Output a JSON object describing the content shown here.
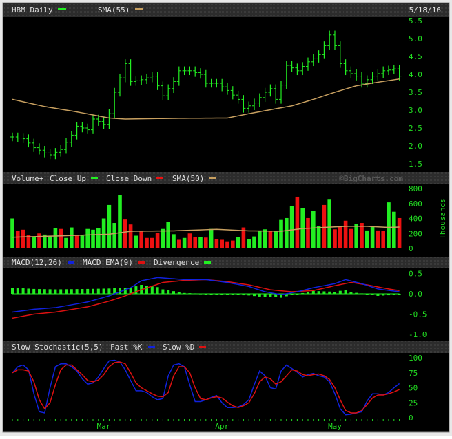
{
  "headers": {
    "price": {
      "symbol": "HBM Daily",
      "sma": "SMA(55)",
      "date": "5/18/16"
    },
    "volume": {
      "label": "Volume+",
      "up": "Close Up",
      "down": "Close Down",
      "sma": "SMA(50)",
      "watermark": "©BigCharts.com",
      "unit": "Thousands"
    },
    "macd": {
      "macd": "MACD(12,26)",
      "ema": "MACD EMA(9)",
      "div": "Divergence"
    },
    "stoch": {
      "label": "Slow Stochastic(5,5)",
      "k": "Fast %K",
      "d": "Slow %D"
    }
  },
  "colors": {
    "up": "#22ee22",
    "down": "#ee1111",
    "sma": "#c8a060",
    "macd": "#1122dd",
    "signal": "#dd1111",
    "axis": "#22dd22"
  },
  "chart_data": [
    {
      "type": "line",
      "title": "HBM Daily",
      "ylim": [
        1.5,
        5.5
      ],
      "yticks": [
        "5.5",
        "5.0",
        "4.5",
        "4.0",
        "3.5",
        "3.0",
        "2.5",
        "2.0",
        "1.5"
      ],
      "close": [
        2.25,
        2.22,
        2.2,
        2.08,
        1.95,
        1.88,
        1.8,
        1.75,
        1.82,
        1.9,
        2.1,
        2.3,
        2.55,
        2.5,
        2.45,
        2.75,
        2.68,
        2.6,
        2.9,
        3.5,
        3.9,
        4.3,
        3.8,
        3.82,
        3.85,
        3.9,
        3.95,
        3.68,
        3.4,
        3.6,
        3.8,
        4.1,
        4.1,
        4.1,
        4.05,
        4.0,
        3.75,
        3.75,
        3.75,
        3.65,
        3.55,
        3.42,
        3.3,
        3.05,
        3.12,
        3.2,
        3.35,
        3.5,
        3.6,
        3.3,
        3.7,
        4.25,
        4.18,
        4.1,
        4.22,
        4.35,
        4.45,
        4.55,
        4.8,
        5.1,
        4.8,
        4.3,
        4.1,
        4.02,
        3.95,
        3.75,
        3.85,
        3.95,
        4.02,
        4.1,
        4.12,
        4.15,
        3.95
      ],
      "sma55": [
        [
          0,
          3.3
        ],
        [
          6,
          3.1
        ],
        [
          12,
          2.95
        ],
        [
          18,
          2.78
        ],
        [
          21,
          2.75
        ],
        [
          30,
          2.77
        ],
        [
          40,
          2.78
        ],
        [
          44,
          2.9
        ],
        [
          52,
          3.12
        ],
        [
          56,
          3.3
        ],
        [
          60,
          3.5
        ],
        [
          64,
          3.68
        ],
        [
          68,
          3.78
        ],
        [
          72,
          3.87
        ]
      ]
    },
    {
      "type": "bar",
      "title": "Volume",
      "ylabel": "Thousands",
      "ylim": [
        0,
        800
      ],
      "yticks": [
        "800",
        "600",
        "400",
        "200",
        "0"
      ],
      "values": [
        400,
        230,
        250,
        175,
        150,
        200,
        185,
        170,
        270,
        260,
        140,
        280,
        175,
        170,
        260,
        250,
        270,
        400,
        580,
        340,
        710,
        385,
        320,
        170,
        225,
        140,
        140,
        210,
        260,
        355,
        190,
        115,
        140,
        200,
        150,
        150,
        145,
        260,
        125,
        115,
        95,
        105,
        150,
        280,
        125,
        160,
        240,
        255,
        230,
        230,
        380,
        405,
        570,
        690,
        540,
        405,
        500,
        300,
        580,
        660,
        255,
        290,
        370,
        260,
        330,
        340,
        240,
        300,
        240,
        230,
        615,
        490,
        405
      ],
      "up": [
        1,
        0,
        0,
        0,
        1,
        0,
        1,
        1,
        1,
        0,
        1,
        1,
        0,
        1,
        1,
        1,
        1,
        1,
        1,
        1,
        1,
        0,
        0,
        1,
        0,
        0,
        0,
        0,
        1,
        1,
        1,
        0,
        1,
        0,
        0,
        1,
        0,
        1,
        0,
        0,
        0,
        0,
        1,
        0,
        1,
        1,
        1,
        1,
        0,
        1,
        1,
        1,
        1,
        0,
        1,
        0,
        1,
        1,
        0,
        1,
        0,
        0,
        0,
        0,
        1,
        0,
        1,
        1,
        0,
        0,
        1,
        1,
        0
      ],
      "sma50": [
        [
          0,
          150
        ],
        [
          10,
          170
        ],
        [
          18,
          190
        ],
        [
          22,
          230
        ],
        [
          30,
          235
        ],
        [
          38,
          255
        ],
        [
          44,
          235
        ],
        [
          50,
          230
        ],
        [
          54,
          265
        ],
        [
          58,
          280
        ],
        [
          62,
          295
        ],
        [
          66,
          295
        ],
        [
          70,
          280
        ],
        [
          72,
          285
        ]
      ]
    },
    {
      "type": "line",
      "title": "MACD(12,26)",
      "ylim": [
        -1.0,
        0.5
      ],
      "yticks": [
        "0.5",
        "0.0",
        "-0.5",
        "-1.0"
      ],
      "macd": [
        [
          0,
          -0.45
        ],
        [
          4,
          -0.38
        ],
        [
          8,
          -0.34
        ],
        [
          14,
          -0.2
        ],
        [
          18,
          -0.05
        ],
        [
          20,
          0.05
        ],
        [
          22,
          0.15
        ],
        [
          24,
          0.32
        ],
        [
          27,
          0.4
        ],
        [
          32,
          0.35
        ],
        [
          36,
          0.35
        ],
        [
          40,
          0.28
        ],
        [
          44,
          0.18
        ],
        [
          47,
          0.05
        ],
        [
          50,
          -0.02
        ],
        [
          53,
          0.05
        ],
        [
          56,
          0.15
        ],
        [
          60,
          0.25
        ],
        [
          62,
          0.35
        ],
        [
          65,
          0.25
        ],
        [
          68,
          0.12
        ],
        [
          72,
          0.05
        ]
      ],
      "signal": [
        [
          0,
          -0.6
        ],
        [
          4,
          -0.5
        ],
        [
          8,
          -0.45
        ],
        [
          14,
          -0.32
        ],
        [
          18,
          -0.18
        ],
        [
          21,
          -0.05
        ],
        [
          24,
          0.1
        ],
        [
          28,
          0.28
        ],
        [
          32,
          0.33
        ],
        [
          36,
          0.35
        ],
        [
          40,
          0.3
        ],
        [
          44,
          0.22
        ],
        [
          48,
          0.1
        ],
        [
          52,
          0.05
        ],
        [
          56,
          0.08
        ],
        [
          60,
          0.2
        ],
        [
          63,
          0.28
        ],
        [
          66,
          0.22
        ],
        [
          70,
          0.12
        ],
        [
          72,
          0.08
        ]
      ]
    },
    {
      "type": "line",
      "title": "Slow Stochastic(5,5)",
      "ylim": [
        0,
        100
      ],
      "yticks": [
        "100",
        "75",
        "50",
        "25",
        "0"
      ],
      "fast_k": [
        75,
        85,
        88,
        80,
        40,
        10,
        8,
        50,
        85,
        90,
        90,
        85,
        78,
        65,
        56,
        58,
        68,
        82,
        95,
        96,
        93,
        80,
        62,
        45,
        45,
        42,
        35,
        30,
        32,
        70,
        88,
        90,
        85,
        55,
        27,
        27,
        30,
        34,
        37,
        25,
        17,
        17,
        18,
        22,
        30,
        55,
        78,
        70,
        50,
        48,
        78,
        88,
        82,
        76,
        68,
        72,
        74,
        70,
        68,
        60,
        40,
        15,
        5,
        6,
        8,
        10,
        28,
        40,
        40,
        38,
        42,
        50,
        57
      ],
      "slow_d": [
        75,
        80,
        80,
        78,
        60,
        30,
        15,
        25,
        55,
        80,
        88,
        88,
        80,
        72,
        62,
        60,
        63,
        72,
        85,
        92,
        93,
        90,
        75,
        58,
        50,
        45,
        40,
        36,
        35,
        42,
        70,
        85,
        85,
        75,
        50,
        32,
        30,
        33,
        35,
        33,
        26,
        20,
        17,
        20,
        25,
        40,
        60,
        68,
        65,
        56,
        60,
        70,
        80,
        78,
        72,
        70,
        72,
        73,
        70,
        64,
        50,
        30,
        12,
        8,
        8,
        12,
        22,
        33,
        38,
        38,
        40,
        43,
        47
      ],
      "xticks": [
        {
          "label": "Mar",
          "index": 17
        },
        {
          "label": "Apr",
          "index": 39
        },
        {
          "label": "May",
          "index": 60
        }
      ]
    }
  ]
}
